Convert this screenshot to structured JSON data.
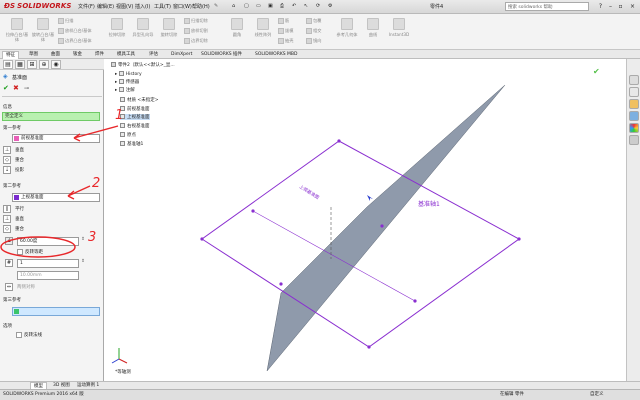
{
  "app": {
    "brand": "SOLIDWORKS",
    "doc_title": "零件4",
    "search_placeholder": "搜索 solidworks 帮助"
  },
  "menu": [
    "文件(F)",
    "编辑(E)",
    "视图(V)",
    "插入(I)",
    "工具(T)",
    "窗口(W)",
    "帮助(H)"
  ],
  "ribbon": {
    "buttons": [
      "拉伸凸台/基体",
      "旋转凸台/基体",
      "扫描",
      "放样凸台/基体",
      "边界凸台/基体",
      "拉伸切除",
      "异型孔向导",
      "旋转切除",
      "扫描切除",
      "放样切割",
      "边界切除",
      "圆角",
      "线性阵列",
      "筋",
      "拔模",
      "抽壳",
      "包覆",
      "相交",
      "镜向",
      "参考几何体",
      "曲线",
      "Instant3D"
    ]
  },
  "tabs": [
    "特征",
    "草图",
    "曲面",
    "钣金",
    "焊件",
    "模具工具",
    "评估",
    "DimXpert",
    "SOLIDWORKS 插件",
    "SOLIDWORKS MBD"
  ],
  "panel": {
    "title": "基准面",
    "message_label": "信息",
    "message": "完全定义",
    "first_ref": {
      "header": "第一参考",
      "value": "前视基准面",
      "options": [
        "垂直",
        "重合",
        "投影"
      ]
    },
    "second_ref": {
      "header": "第二参考",
      "value": "上视基准面",
      "options": [
        "平行",
        "垂直",
        "重合"
      ],
      "angle": "60.00度",
      "flip": "反转等距",
      "count": "1",
      "dist": "10.00mm",
      "mid": "两侧对称"
    },
    "third_ref": {
      "header": "第三参考"
    },
    "options": {
      "header": "选项",
      "flip_normal": "反转法线"
    }
  },
  "tree": {
    "root": "零件2（默认<<默认>_显...",
    "items": [
      "History",
      "传感器",
      "注解",
      "材质 <未指定>",
      "前视基准面",
      "上视基准面",
      "右视基准面",
      "原点",
      "基准轴1"
    ]
  },
  "canvas": {
    "plane_label": "上视基准面",
    "axis_label": "基准轴1",
    "view_label": "*等轴测"
  },
  "annotations": [
    "1",
    "2",
    "3"
  ],
  "bottom_tabs": [
    "模型",
    "3D 视图",
    "运动算例 1"
  ],
  "status": {
    "left": "SOLIDWORKS Premium 2016 x64 版",
    "mid": "在编辑 零件",
    "right": "自定义"
  },
  "colors": {
    "annotation": "#e8282b",
    "plane_fill": "#8f9aab",
    "plane_outline": "#8a2fd0",
    "message_bg": "#b9f0b0"
  }
}
